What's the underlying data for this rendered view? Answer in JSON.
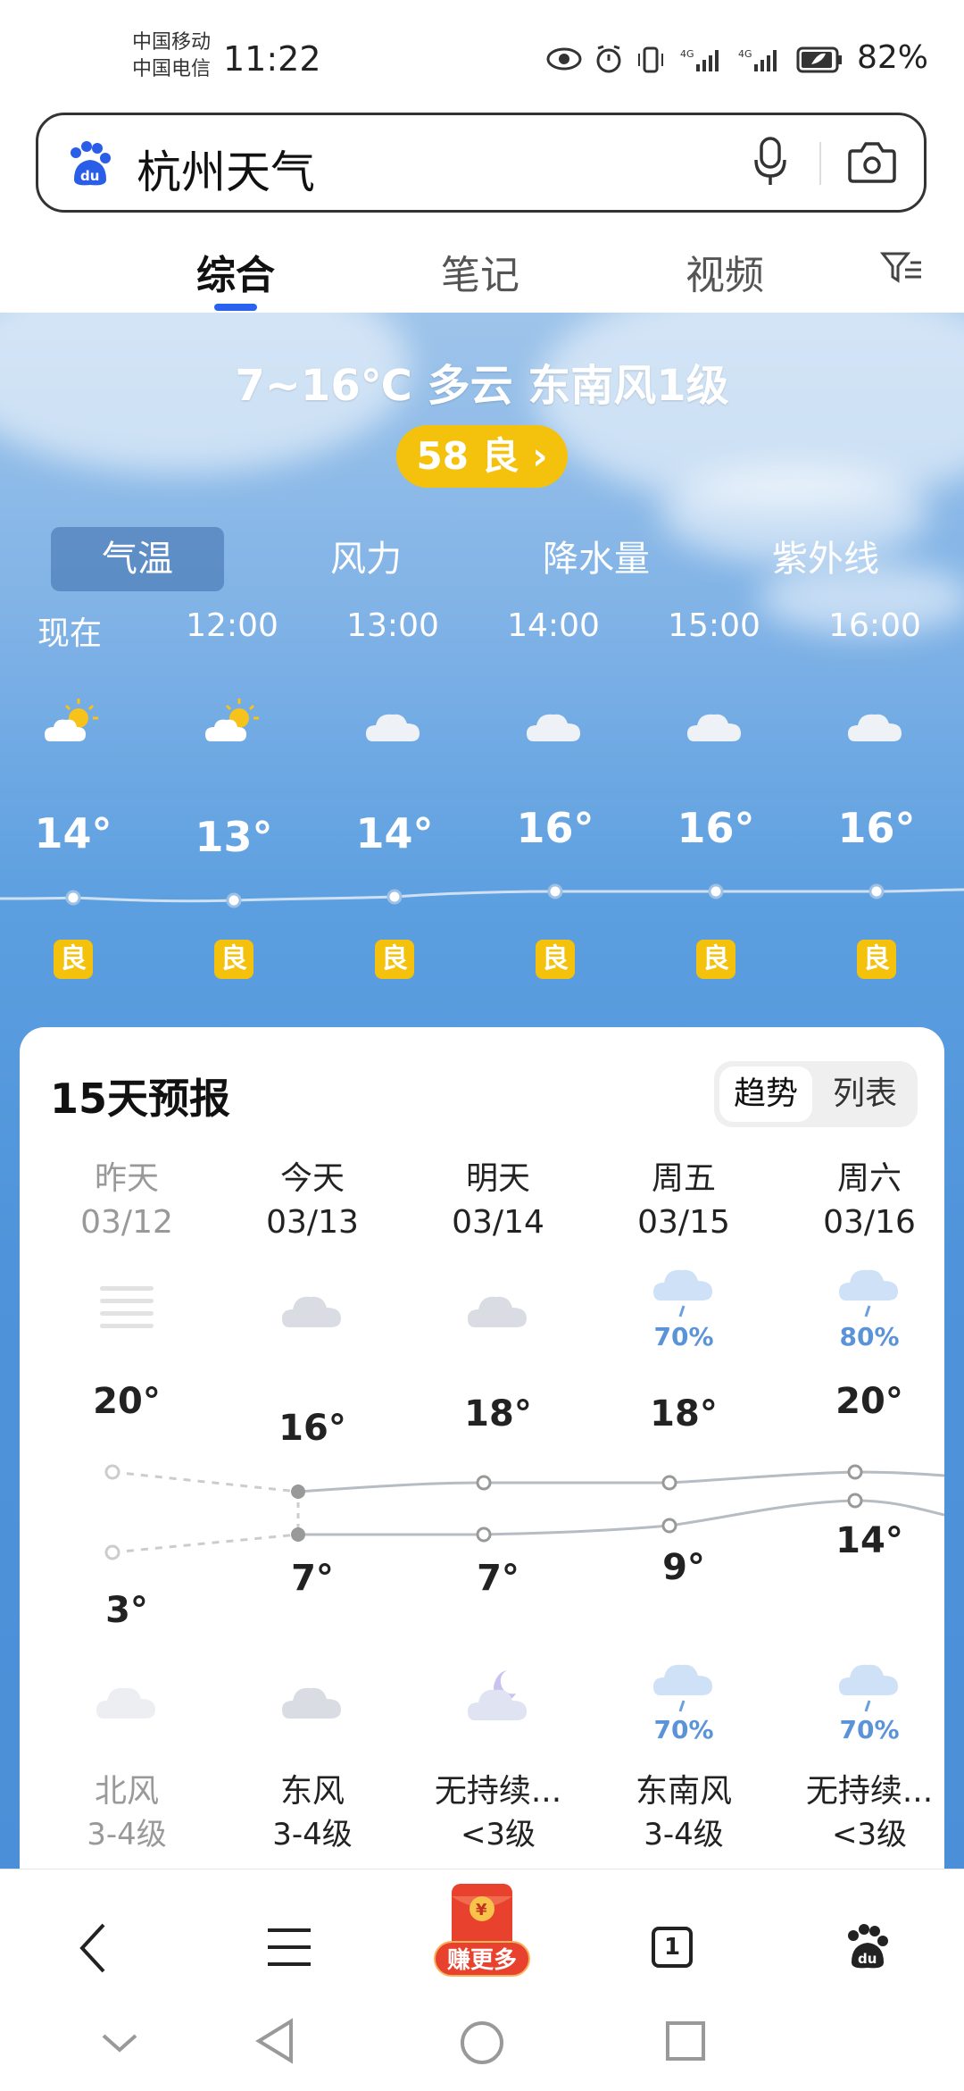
{
  "status": {
    "carrier1": "中国移动",
    "carrier2": "中国电信",
    "time": "11:22",
    "battery": "82%"
  },
  "search": {
    "query": "杭州天气"
  },
  "tabs": [
    {
      "label": "综合"
    },
    {
      "label": "笔记"
    },
    {
      "label": "视频"
    }
  ],
  "weather": {
    "summary": "7~16℃ 多云 东南风1级",
    "aqi": "58 良",
    "metric_tabs": [
      {
        "label": "气温"
      },
      {
        "label": "风力"
      },
      {
        "label": "降水量"
      },
      {
        "label": "紫外线"
      }
    ],
    "hourly": [
      {
        "time": "现在",
        "temp": "14°",
        "aqi": "良",
        "icon": "partly-sunny-icon"
      },
      {
        "time": "12:00",
        "temp": "13°",
        "aqi": "良",
        "icon": "partly-sunny-icon"
      },
      {
        "time": "13:00",
        "temp": "14°",
        "aqi": "良",
        "icon": "cloudy-icon"
      },
      {
        "time": "14:00",
        "temp": "16°",
        "aqi": "良",
        "icon": "cloudy-icon"
      },
      {
        "time": "15:00",
        "temp": "16°",
        "aqi": "良",
        "icon": "cloudy-icon"
      },
      {
        "time": "16:00",
        "temp": "16°",
        "aqi": "良",
        "icon": "cloudy-icon"
      }
    ]
  },
  "forecast": {
    "title": "15天预报",
    "toggle": {
      "trend": "趋势",
      "list": "列表"
    },
    "days": [
      {
        "name": "昨天",
        "date": "03/12",
        "hi": "20°",
        "lo": "3°",
        "day_icon": "haze-icon",
        "day_pct": "",
        "night_icon": "cloudy-icon",
        "night_pct": "",
        "wind": "北风",
        "wind_level": "3-4级"
      },
      {
        "name": "今天",
        "date": "03/13",
        "hi": "16°",
        "lo": "7°",
        "day_icon": "cloudy-icon",
        "day_pct": "",
        "night_icon": "cloudy-icon",
        "night_pct": "",
        "wind": "东风",
        "wind_level": "3-4级"
      },
      {
        "name": "明天",
        "date": "03/14",
        "hi": "18°",
        "lo": "7°",
        "day_icon": "cloudy-icon",
        "day_pct": "",
        "night_icon": "cloudy-night-icon",
        "night_pct": "",
        "wind": "无持续...",
        "wind_level": "<3级"
      },
      {
        "name": "周五",
        "date": "03/15",
        "hi": "18°",
        "lo": "9°",
        "day_icon": "rain-icon",
        "day_pct": "70%",
        "night_icon": "rain-icon",
        "night_pct": "70%",
        "wind": "东南风",
        "wind_level": "3-4级"
      },
      {
        "name": "周六",
        "date": "03/16",
        "hi": "20°",
        "lo": "14°",
        "day_icon": "rain-icon",
        "day_pct": "80%",
        "night_icon": "rain-icon",
        "night_pct": "70%",
        "wind": "无持续...",
        "wind_level": "<3级"
      }
    ]
  },
  "nav": {
    "promo": "赚更多",
    "tab_count": "1"
  }
}
